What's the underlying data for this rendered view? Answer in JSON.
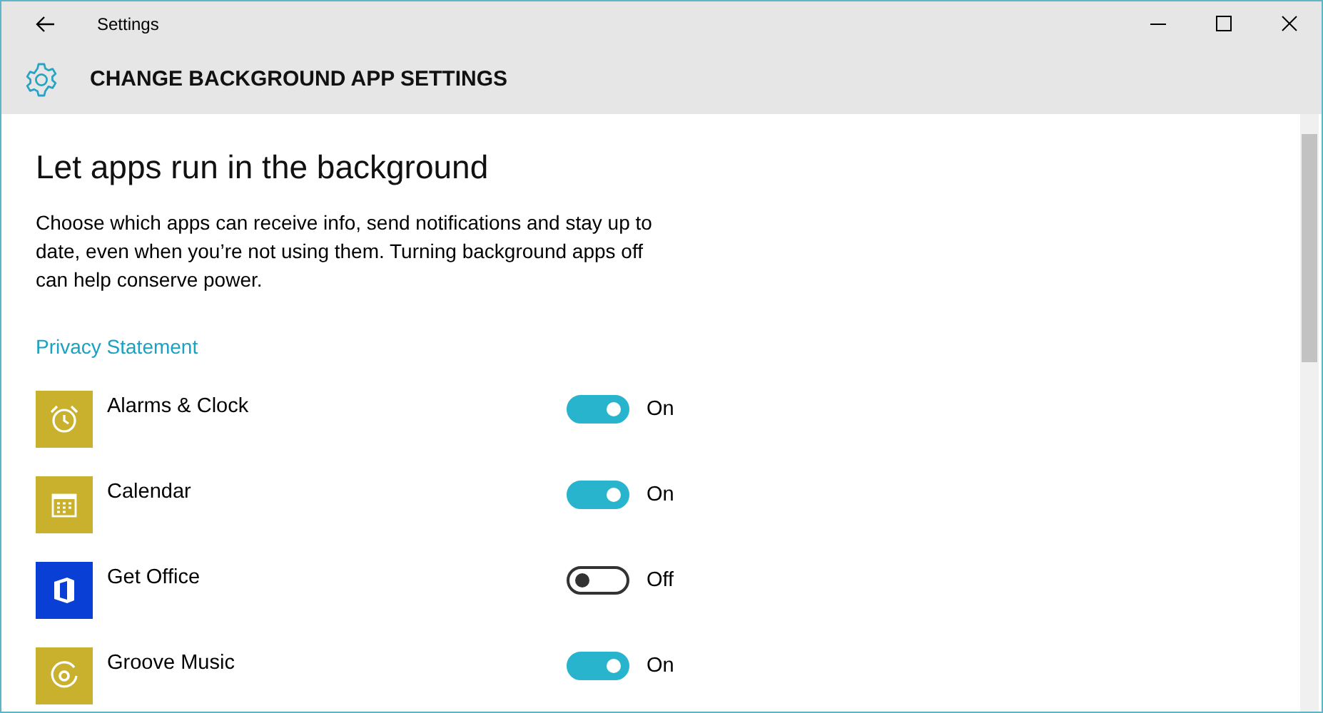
{
  "window": {
    "title": "Settings"
  },
  "header": {
    "title": "CHANGE BACKGROUND APP SETTINGS"
  },
  "content": {
    "heading": "Let apps run in the background",
    "description": "Choose which apps can receive info, send notifications and stay up to date, even when you’re not using them. Turning background apps off can help conserve power.",
    "link": "Privacy Statement"
  },
  "apps": [
    {
      "name": "Alarms & Clock",
      "kind": "alarm",
      "color": "#c9b12e",
      "on": true,
      "state_label": "On"
    },
    {
      "name": "Calendar",
      "kind": "calendar",
      "color": "#c9b12e",
      "on": true,
      "state_label": "On"
    },
    {
      "name": "Get Office",
      "kind": "office",
      "color": "#0a3fd6",
      "on": false,
      "state_label": "Off"
    },
    {
      "name": "Groove Music",
      "kind": "music",
      "color": "#c9b12e",
      "on": true,
      "state_label": "On"
    }
  ]
}
